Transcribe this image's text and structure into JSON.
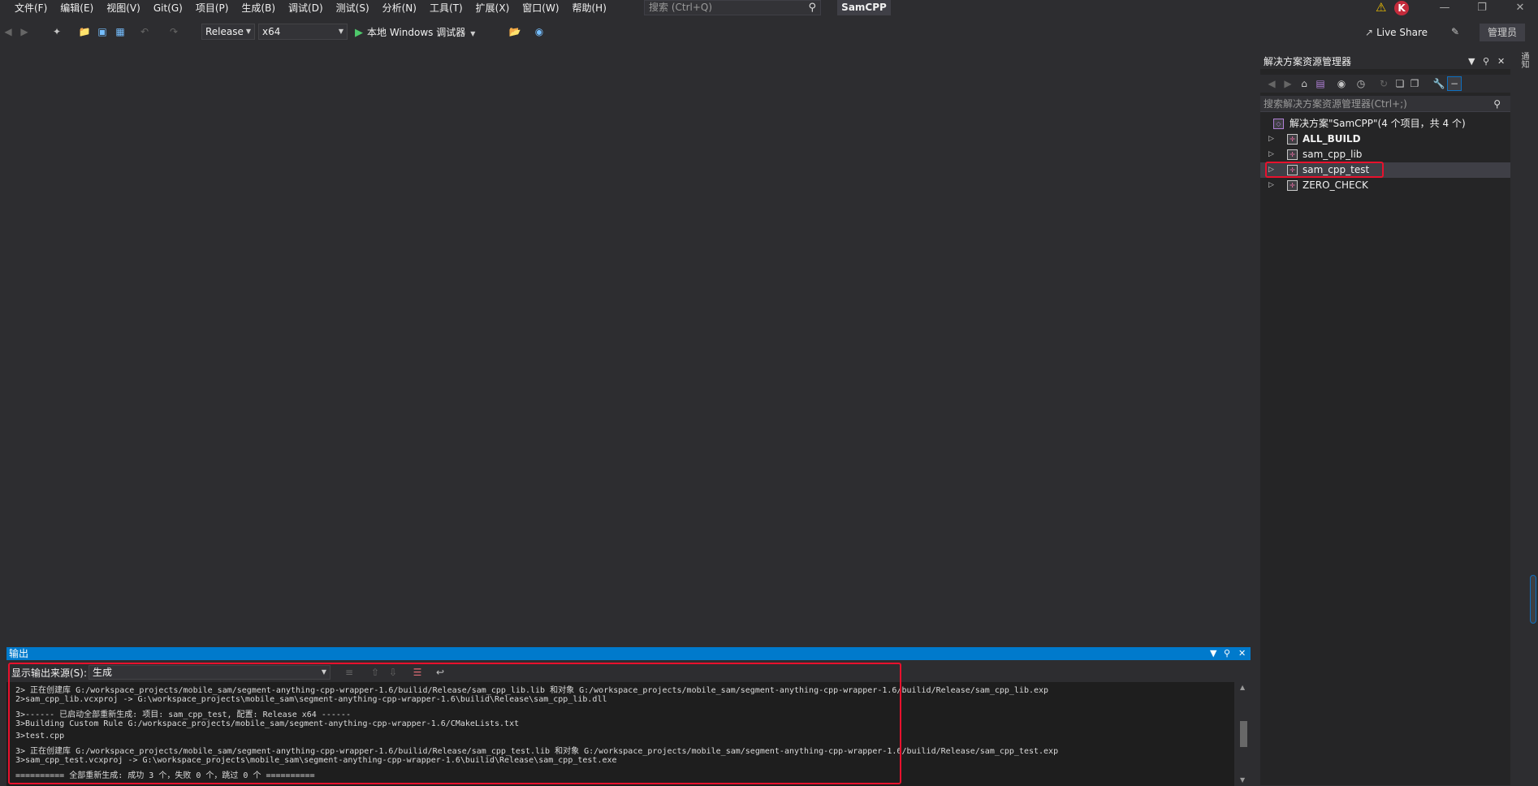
{
  "menu": [
    "文件(F)",
    "编辑(E)",
    "视图(V)",
    "Git(G)",
    "项目(P)",
    "生成(B)",
    "调试(D)",
    "测试(S)",
    "分析(N)",
    "工具(T)",
    "扩展(X)",
    "窗口(W)",
    "帮助(H)"
  ],
  "search": {
    "placeholder": "搜索 (Ctrl+Q)"
  },
  "app_title": "SamCPP",
  "user_initial": "K",
  "toolbar": {
    "config": "Release",
    "platform": "x64",
    "run_label": "本地 Windows 调试器",
    "live_share": "Live Share",
    "admin": "管理员"
  },
  "solution_explorer": {
    "title": "解决方案资源管理器",
    "search_placeholder": "搜索解决方案资源管理器(Ctrl+;)",
    "solution_label": "解决方案\"SamCPP\"(4 个项目，共 4 个)",
    "projects": [
      "ALL_BUILD",
      "sam_cpp_lib",
      "sam_cpp_test",
      "ZERO_CHECK"
    ],
    "selected": "sam_cpp_test"
  },
  "right_tab": "通知",
  "output": {
    "title": "输出",
    "source_label": "显示输出来源(S):",
    "source_value": "生成",
    "lines": [
      "2>  正在创建库 G:/workspace_projects/mobile_sam/segment-anything-cpp-wrapper-1.6/builid/Release/sam_cpp_lib.lib 和对象 G:/workspace_projects/mobile_sam/segment-anything-cpp-wrapper-1.6/builid/Release/sam_cpp_lib.exp",
      "2>sam_cpp_lib.vcxproj -> G:\\workspace_projects\\mobile_sam\\segment-anything-cpp-wrapper-1.6\\builid\\Release\\sam_cpp_lib.dll",
      "3>------ 已启动全部重新生成: 项目: sam_cpp_test, 配置: Release x64 ------",
      "3>Building Custom Rule G:/workspace_projects/mobile_sam/segment-anything-cpp-wrapper-1.6/CMakeLists.txt",
      "3>test.cpp",
      "3>  正在创建库 G:/workspace_projects/mobile_sam/segment-anything-cpp-wrapper-1.6/builid/Release/sam_cpp_test.lib 和对象 G:/workspace_projects/mobile_sam/segment-anything-cpp-wrapper-1.6/builid/Release/sam_cpp_test.exp",
      "3>sam_cpp_test.vcxproj -> G:\\workspace_projects\\mobile_sam\\segment-anything-cpp-wrapper-1.6\\builid\\Release\\sam_cpp_test.exe",
      "========== 全部重新生成: 成功 3 个，失败 0 个，跳过 0 个 =========="
    ]
  }
}
